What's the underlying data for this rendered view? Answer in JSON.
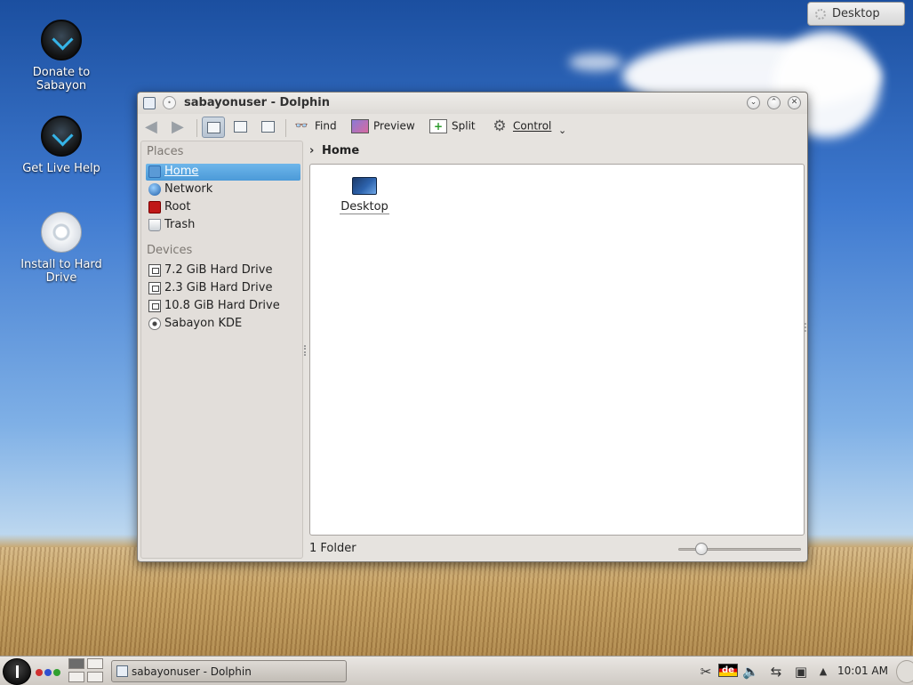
{
  "desktop": {
    "icons": [
      {
        "label": "Donate to Sabayon",
        "icon": "sabayon-download-icon"
      },
      {
        "label": "Get Live Help",
        "icon": "sabayon-download-icon"
      },
      {
        "label": "Install to Hard Drive",
        "icon": "cd-disc-icon"
      }
    ],
    "activity_button_label": "Desktop"
  },
  "window": {
    "title": "sabayonuser - Dolphin",
    "toolbar": {
      "find": "Find",
      "preview": "Preview",
      "split": "Split",
      "control": "Control"
    },
    "places": {
      "heading": "Places",
      "items": [
        {
          "label": "Home",
          "icon": "home-folder-icon",
          "selected": true
        },
        {
          "label": "Network",
          "icon": "globe-icon"
        },
        {
          "label": "Root",
          "icon": "red-folder-icon"
        },
        {
          "label": "Trash",
          "icon": "trash-icon"
        }
      ]
    },
    "devices": {
      "heading": "Devices",
      "items": [
        {
          "label": "7.2 GiB Hard Drive",
          "icon": "drive-icon"
        },
        {
          "label": "2.3 GiB Hard Drive",
          "icon": "drive-icon"
        },
        {
          "label": "10.8 GiB Hard Drive",
          "icon": "drive-icon"
        },
        {
          "label": "Sabayon KDE",
          "icon": "optical-disc-icon"
        }
      ]
    },
    "breadcrumb": "Home",
    "files": [
      {
        "name": "Desktop",
        "icon": "desktop-folder-icon"
      }
    ],
    "status": "1 Folder",
    "zoom_level": 0.15
  },
  "taskbar": {
    "task_label": "sabayonuser - Dolphin",
    "keyboard_layout": "de",
    "clock": "10:01 AM"
  },
  "colors": {
    "selection": "#4b9ad8",
    "sabayon_accent": "#35b4e8"
  }
}
